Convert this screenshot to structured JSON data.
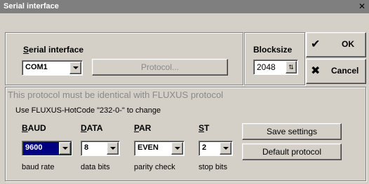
{
  "window": {
    "title": "Serial interface"
  },
  "serial": {
    "label_prefix": "S",
    "label_rest": "erial interface",
    "port_value": "COM1",
    "protocol_button": "Protocol..."
  },
  "blocksize": {
    "label": "Blocksize",
    "value": "2048"
  },
  "actions": {
    "ok": "OK",
    "cancel": "Cancel"
  },
  "protocol_info": {
    "title": "This protocol must be identical with FLUXUS protocol",
    "hint": "Use FLUXUS-HotCode \"232-0-\" to change"
  },
  "params": [
    {
      "head_u": "B",
      "head_rest": "AUD",
      "value": "9600",
      "caption": "baud rate"
    },
    {
      "head_u": "D",
      "head_rest": "ATA",
      "value": "8",
      "caption": "data bits"
    },
    {
      "head_u": "P",
      "head_rest": "AR",
      "value": "EVEN",
      "caption": "parity check"
    },
    {
      "head_u": "S",
      "head_rest": "T",
      "value": "2",
      "caption": "stop bits"
    }
  ],
  "buttons": {
    "save": "Save settings",
    "default": "Default protocol"
  },
  "colors": {
    "titlebar": "#7f7f7f",
    "face": "#d4d0c8",
    "selected_combo": "#000080"
  }
}
